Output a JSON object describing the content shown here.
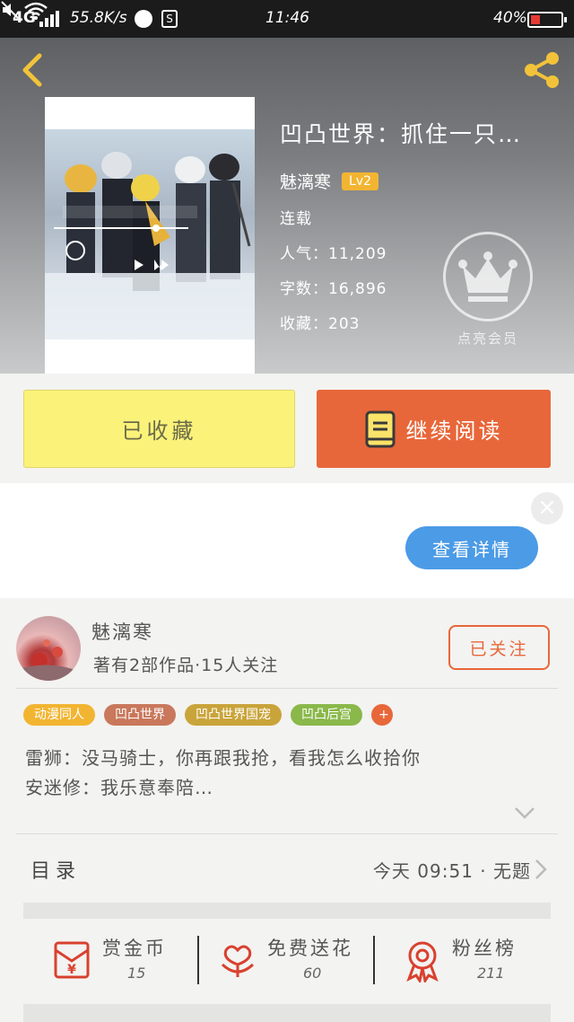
{
  "status_bar": {
    "network": "4G",
    "speed": "55.8K/s",
    "time": "11:46",
    "battery": "40%"
  },
  "book": {
    "title": "凹凸世界：抓住一只…",
    "author": "魅漓寒",
    "level": "Lv2",
    "status": "连载",
    "popularity_label": "人气：",
    "popularity": "11,209",
    "words_label": "字数：",
    "words": "16,896",
    "favorites_label": "收藏：",
    "favorites": "203",
    "vip_label": "点亮会员"
  },
  "actions": {
    "favorited_label": "已收藏",
    "continue_label": "继续阅读"
  },
  "ad": {
    "details_label": "查看详情",
    "close_glyph": "×"
  },
  "author": {
    "name": "魅漓寒",
    "stats": "著有2部作品·15人关注",
    "follow_label": "已关注"
  },
  "tags": [
    {
      "label": "动漫同人",
      "color": "#f2b532"
    },
    {
      "label": "凹凸世界",
      "color": "#c9785c"
    },
    {
      "label": "凹凸世界国宠",
      "color": "#c9a43a"
    },
    {
      "label": "凹凸后宫",
      "color": "#8ab84a"
    },
    {
      "label": "+",
      "color": "#e8673a"
    }
  ],
  "excerpt": {
    "line1": "雷狮：没马骑士，你再跟我抢，看我怎么收拾你",
    "line2": "安迷修：我乐意奉陪…"
  },
  "toc": {
    "label": "目录",
    "latest": "今天 09:51 · 无题"
  },
  "stats": {
    "reward": {
      "label": "赏金币",
      "value": "15"
    },
    "flowers": {
      "label": "免费送花",
      "value": "60"
    },
    "fans": {
      "label": "粉丝榜",
      "value": "211"
    }
  },
  "colors": {
    "accent_orange": "#e8673a",
    "fav_yellow": "#fbf27a",
    "ad_blue": "#4c9be6",
    "level_badge": "#f2b532"
  },
  "icons": [
    "back-arrow-icon",
    "share-icon",
    "crown-icon",
    "book-icon",
    "chevron-down-icon",
    "chevron-right-icon",
    "red-envelope-icon",
    "flower-icon",
    "ribbon-medal-icon",
    "close-icon"
  ]
}
